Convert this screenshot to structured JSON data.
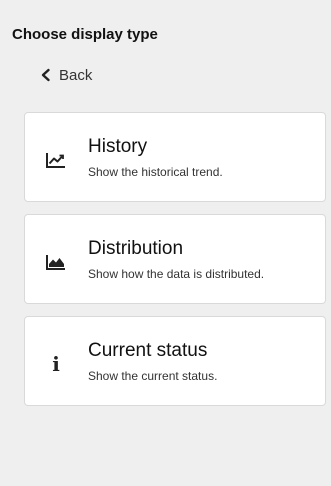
{
  "header": {
    "title": "Choose display type",
    "back_label": "Back",
    "back_icon": "chevron-left-icon"
  },
  "options": [
    {
      "title": "History",
      "description": "Show the historical trend.",
      "icon": "line-chart-icon"
    },
    {
      "title": "Distribution",
      "description": "Show how the data is distributed.",
      "icon": "area-chart-icon"
    },
    {
      "title": "Current status",
      "description": "Show the current status.",
      "icon": "info-icon",
      "icon_glyph": "i"
    }
  ],
  "colors": {
    "background": "#efefef",
    "card": "#ffffff",
    "card_border": "#d9d9d9",
    "text": "#111111"
  }
}
